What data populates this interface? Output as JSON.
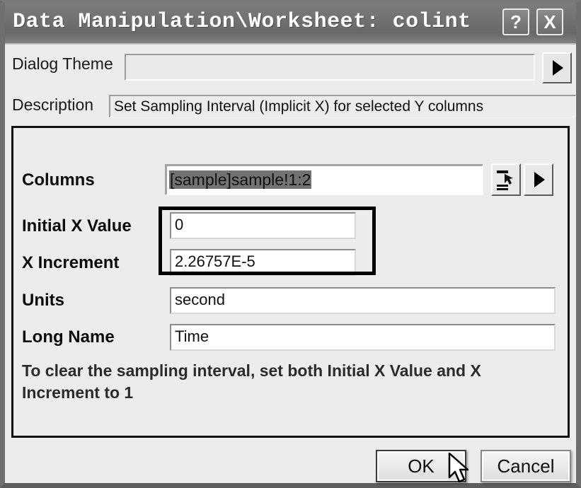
{
  "window": {
    "title": "Data Manipulation\\Worksheet: colint",
    "help_button": "?",
    "close_button": "X"
  },
  "top": {
    "dialog_theme_label": "Dialog Theme",
    "dialog_theme_value": "",
    "dialog_theme_placeholder": "",
    "dialog_theme_arrow_icon": "triangle-right-icon",
    "description_label": "Description",
    "description_value": "Set Sampling Interval (Implicit X) for selected Y columns"
  },
  "form": {
    "columns": {
      "label": "Columns",
      "value": "[sample]sample!1:2",
      "pick_icon": "select-columns-icon",
      "arrow_icon": "triangle-right-icon"
    },
    "initial_x_value": {
      "label": "Initial X Value",
      "value": "0"
    },
    "x_increment": {
      "label": "X Increment",
      "value": "2.26757E-5"
    },
    "units": {
      "label": "Units",
      "value": "second"
    },
    "long_name": {
      "label": "Long Name",
      "value": "Time"
    },
    "hint": "To clear the sampling interval, set both Initial X Value and X Increment to 1"
  },
  "footer": {
    "ok_label": "OK",
    "cancel_label": "Cancel"
  },
  "colors": {
    "titlebar": "#707070",
    "dialog_face": "#ececec",
    "highlight_box": "#000000",
    "selection": "#737373",
    "text": "#111111"
  }
}
